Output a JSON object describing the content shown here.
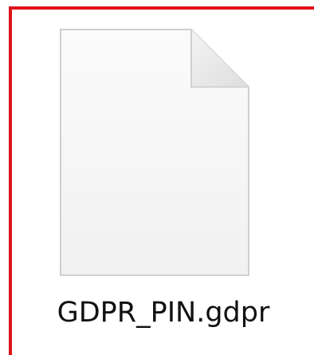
{
  "file": {
    "name": "GDPR_PIN.gdpr",
    "icon": "blank-document-icon"
  },
  "colors": {
    "selection_border": "#e0131b",
    "icon_fill": "#f7f7f7",
    "icon_outline": "#cfcfcf",
    "icon_fold": "#e6e6e6",
    "text": "#111111"
  }
}
